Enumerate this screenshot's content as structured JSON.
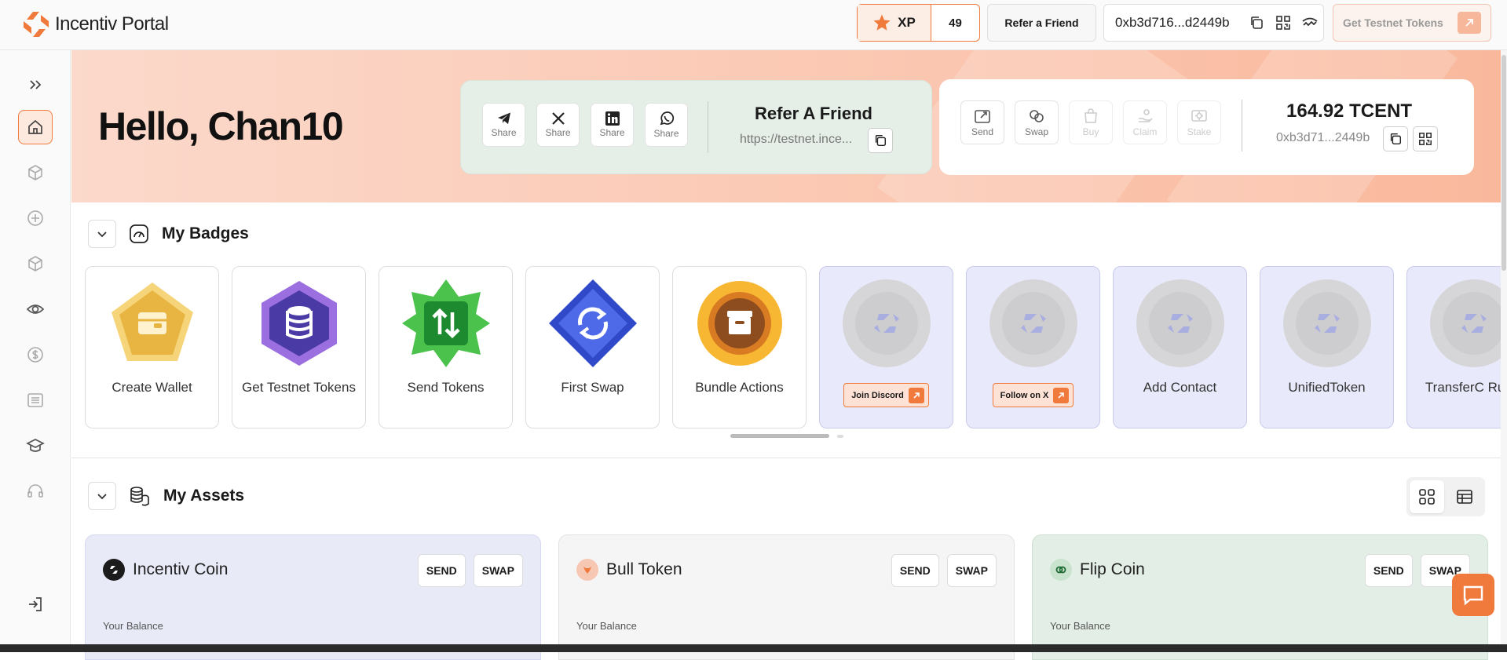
{
  "app": {
    "brand": "Incentiv Portal"
  },
  "topbar": {
    "xp_label": "XP",
    "xp_value": "49",
    "refer_label": "Refer a Friend",
    "wallet_address": "0xb3d716...d2449b",
    "get_tokens_label": "Get Testnet Tokens"
  },
  "sidebar": {
    "items": [
      "expand",
      "home",
      "cube",
      "plus-circle",
      "box",
      "eye",
      "dollar",
      "list",
      "graduation",
      "headset",
      "logout"
    ]
  },
  "hero": {
    "greeting": "Hello, Chan10",
    "share_label": "Share",
    "refer_title": "Refer A Friend",
    "refer_link": "https://testnet.ince...",
    "balance": "164.92 TCENT",
    "short_address": "0xb3d71...2449b",
    "actions": [
      {
        "label": "Send",
        "enabled": true
      },
      {
        "label": "Swap",
        "enabled": true
      },
      {
        "label": "Buy",
        "enabled": false
      },
      {
        "label": "Claim",
        "enabled": false
      },
      {
        "label": "Stake",
        "enabled": false
      }
    ]
  },
  "badges": {
    "title": "My Badges",
    "items": [
      {
        "label": "Create Wallet",
        "earned": true
      },
      {
        "label": "Get Testnet Tokens",
        "earned": true
      },
      {
        "label": "Send Tokens",
        "earned": true
      },
      {
        "label": "First Swap",
        "earned": true
      },
      {
        "label": "Bundle Actions",
        "earned": true
      },
      {
        "label": "Join Discord",
        "earned": false,
        "action": true
      },
      {
        "label": "Follow on X",
        "earned": false,
        "action": true
      },
      {
        "label": "Add Contact",
        "earned": false
      },
      {
        "label": "UnifiedToken",
        "earned": false
      },
      {
        "label": "TransferC Rules",
        "earned": false
      }
    ]
  },
  "assets": {
    "title": "My Assets",
    "balance_label": "Your Balance",
    "send_label": "SEND",
    "swap_label": "SWAP",
    "items": [
      {
        "name": "Incentiv Coin",
        "bg": "#e8eaf8",
        "icon_bg": "#1c1c1c"
      },
      {
        "name": "Bull Token",
        "bg": "#f5f5f5",
        "icon_bg": "#f6c7b2"
      },
      {
        "name": "Flip Coin",
        "bg": "#e3eee6",
        "icon_bg": "#c9e3cf"
      }
    ]
  },
  "colors": {
    "accent": "#f07a3c",
    "locked_badge": "#e8e9fa"
  }
}
